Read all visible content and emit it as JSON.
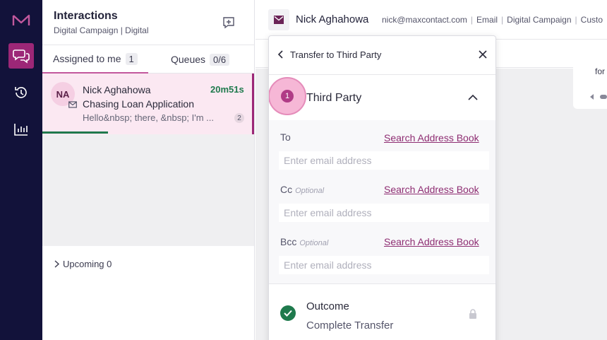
{
  "colors": {
    "rail_bg": "#12123a",
    "accent": "#9c2777",
    "success": "#1f7a4d",
    "card_bg": "#fbe8f2"
  },
  "rail": {
    "items": [
      {
        "icon": "maxcontact-logo-icon"
      },
      {
        "icon": "chat-bubbles-icon",
        "active": true
      },
      {
        "icon": "history-icon"
      },
      {
        "icon": "bar-chart-icon"
      }
    ]
  },
  "panel": {
    "title": "Interactions",
    "subtitle": "Digital Campaign | Digital",
    "tabs": [
      {
        "label": "Assigned to me",
        "count": "1"
      },
      {
        "label": "Queues",
        "count": "0/6"
      }
    ],
    "card": {
      "initials": "NA",
      "name": "Nick Aghahowa",
      "timer": "20m51s",
      "subject": "Chasing Loan Application",
      "preview": "Hello&nbsp; there, &nbsp; I'm ...",
      "badge": "2",
      "progress": 0.31
    },
    "upcoming": "Upcoming 0"
  },
  "topbar": {
    "name": "Nick Aghahowa",
    "meta": [
      "nick@maxcontact.com",
      "Email",
      "Digital Campaign",
      "Custo"
    ]
  },
  "message": {
    "text": "for"
  },
  "modal": {
    "title": "Transfer to Third Party",
    "section": {
      "step": "1",
      "title": "Third Party"
    },
    "fields": [
      {
        "label": "To",
        "optional": "",
        "link": "Search Address Book",
        "placeholder": "Enter email address"
      },
      {
        "label": "Cc",
        "optional": "Optional",
        "link": "Search Address Book",
        "placeholder": "Enter email address"
      },
      {
        "label": "Bcc",
        "optional": "Optional",
        "link": "Search Address Book",
        "placeholder": "Enter email address"
      }
    ],
    "outcome": {
      "title": "Outcome",
      "value": "Complete Transfer"
    }
  }
}
